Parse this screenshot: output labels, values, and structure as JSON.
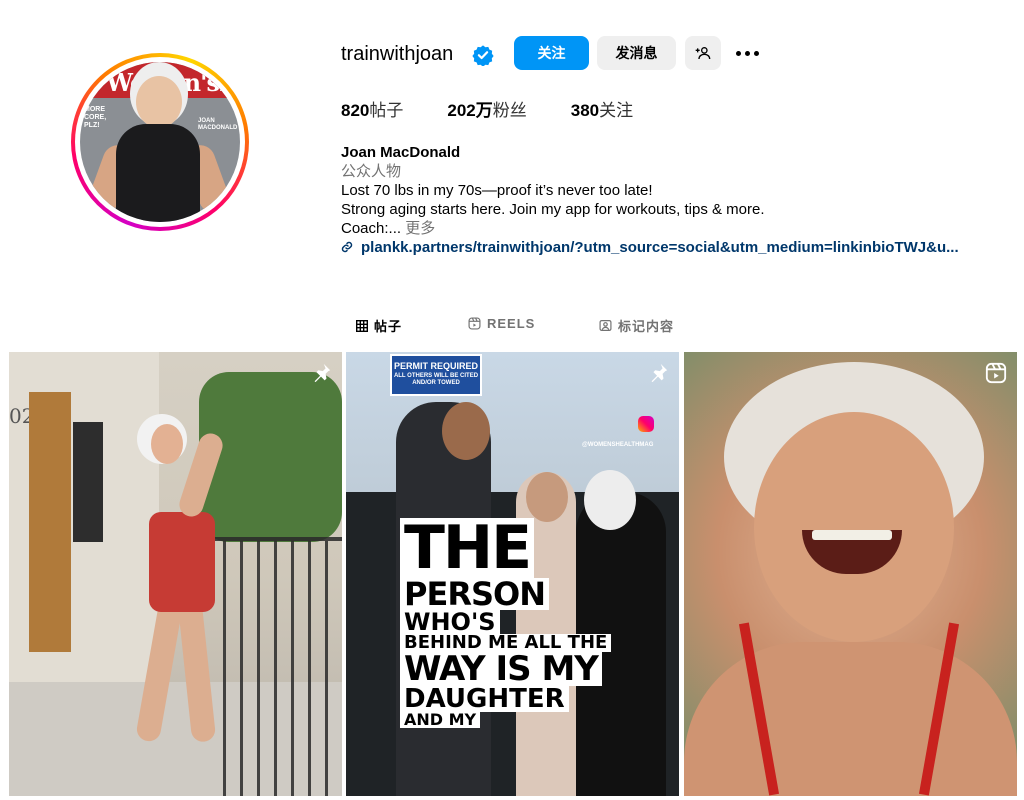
{
  "profile": {
    "username": "trainwithjoan",
    "verified": true,
    "avatar_cover": {
      "masthead": "Women'sHealth",
      "left_text": "MORE CORE, PLZ!",
      "right_text": "JOAN MACDONALD"
    }
  },
  "actions": {
    "follow_label": "关注",
    "message_label": "发消息",
    "add_user_icon": "person-add-icon",
    "more_icon": "more-horizontal-icon"
  },
  "stats": {
    "posts_count": "820",
    "posts_label": "帖子",
    "followers_count": "202万",
    "followers_label": "粉丝",
    "following_count": "380",
    "following_label": "关注"
  },
  "bio": {
    "name": "Joan MacDonald",
    "category": "公众人物",
    "line1": "Lost 70 lbs in my 70s—proof it’s never too late!",
    "line2": "Strong aging starts here. Join my app for workouts, tips & more.",
    "line3": "Coach:...",
    "more_label": "更多",
    "link": "plankk.partners/trainwithjoan/?utm_source=social&utm_medium=linkinbioTWJ&u..."
  },
  "tabs": [
    {
      "label": "帖子",
      "icon": "grid-icon",
      "active": true
    },
    {
      "label": "REELS",
      "icon": "reels-icon",
      "active": false
    },
    {
      "label": "标记内容",
      "icon": "tagged-icon",
      "active": false
    }
  ],
  "posts": [
    {
      "type": "image",
      "badge_icon": "pin-icon",
      "door_number": "02"
    },
    {
      "type": "image",
      "badge_icon": "pin-icon",
      "sign_title": "PERMIT REQUIRED",
      "sign_sub": "ALL OTHERS WILL BE CITED AND/OR TOWED",
      "handle": "@WOMENSHEALTHMAG",
      "overlay_lines": [
        "THE",
        "PERSON",
        "WHO'S",
        "BEHIND ME ALL THE",
        "WAY IS MY",
        "DAUGHTER",
        "AND MY"
      ]
    },
    {
      "type": "reel",
      "badge_icon": "reels-icon"
    }
  ],
  "colors": {
    "primary_blue": "#0095f6",
    "secondary_button": "#efefef",
    "link_color": "#00376b",
    "muted_text": "#737373",
    "verified_blue": "#0095f6"
  }
}
